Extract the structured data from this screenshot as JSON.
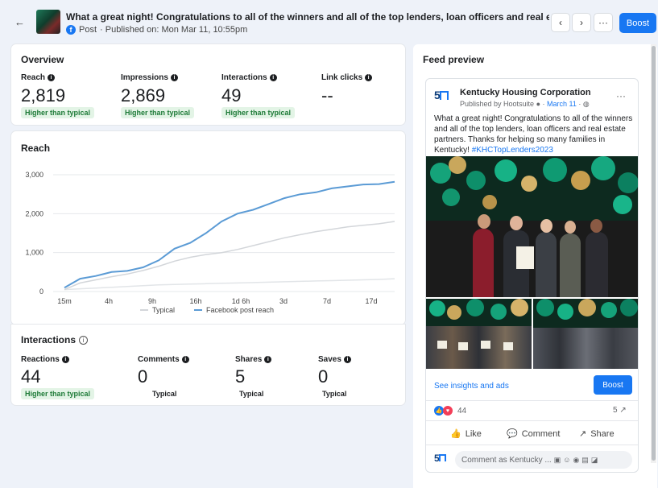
{
  "header": {
    "back_icon": "arrow-left-icon",
    "title": "What a great night! Congratulations to all of the winners and all of the top lenders, loan officers and real estate partn...",
    "post_type": "Post",
    "published": "· Published on: Mon Mar 11, 10:55pm",
    "prev_glyph": "‹",
    "next_glyph": "›",
    "more_glyph": "···",
    "boost_label": "Boost"
  },
  "overview": {
    "title": "Overview",
    "metrics": [
      {
        "label": "Reach",
        "value": "2,819",
        "badge": "Higher than typical"
      },
      {
        "label": "Impressions",
        "value": "2,869",
        "badge": "Higher than typical"
      },
      {
        "label": "Interactions",
        "value": "49",
        "badge": "Higher than typical"
      },
      {
        "label": "Link clicks",
        "value": "--",
        "badge": ""
      }
    ]
  },
  "reach_chart": {
    "title": "Reach",
    "legend_typical": "Typical",
    "legend_reach": "Facebook post reach"
  },
  "chart_data": {
    "type": "line",
    "y_ticks": [
      "0",
      "1,000",
      "2,000",
      "3,000"
    ],
    "ylim": [
      0,
      3000
    ],
    "x_ticks": [
      "15m",
      "4h",
      "9h",
      "16h",
      "1d 6h",
      "3d",
      "7d",
      "17d"
    ],
    "series": [
      {
        "name": "Facebook post reach",
        "color": "#5b9bd5",
        "values": [
          100,
          330,
          400,
          500,
          530,
          620,
          800,
          1100,
          1250,
          1500,
          1800,
          2000,
          2100,
          2250,
          2400,
          2500,
          2550,
          2650,
          2700,
          2750,
          2760,
          2820
        ]
      },
      {
        "name": "Typical",
        "color": "#d3d6da",
        "values": [
          50,
          220,
          300,
          380,
          450,
          540,
          650,
          780,
          880,
          950,
          1000,
          1080,
          1180,
          1280,
          1380,
          1460,
          1540,
          1600,
          1660,
          1700,
          1740,
          1800
        ]
      },
      {
        "name": "",
        "color": "#e2e5e8",
        "values": [
          50,
          70,
          90,
          110,
          130,
          150,
          170,
          180,
          190,
          200,
          210,
          220,
          230,
          240,
          250,
          260,
          270,
          280,
          290,
          300,
          310,
          330
        ]
      }
    ],
    "grid": true
  },
  "interactions": {
    "title": "Interactions",
    "info_icon": "info-circle-icon",
    "metrics": [
      {
        "label": "Reactions",
        "value": "44",
        "badge": "Higher than typical"
      },
      {
        "label": "Comments",
        "value": "0",
        "badge": "Typical"
      },
      {
        "label": "Shares",
        "value": "5",
        "badge": "Typical"
      },
      {
        "label": "Saves",
        "value": "0",
        "badge": "Typical"
      }
    ]
  },
  "feed_preview": {
    "title": "Feed preview",
    "page_name": "Kentucky Housing Corporation",
    "published_by": "Published by Hootsuite",
    "date": "March 11",
    "post_text": "What a great night! Congratulations to all of the winners and all of the top lenders, loan officers and real estate partners. Thanks for helping so many families in Kentucky! ",
    "hashtag": "#KHCTopLenders2023",
    "insights_link": "See insights and ads",
    "boost_label": "Boost",
    "reactions_count": "44",
    "shares_count": "5",
    "like_label": "Like",
    "comment_label": "Comment",
    "share_label": "Share",
    "comment_placeholder": "Comment as Kentucky ..."
  },
  "colors": {
    "accent": "#1877f2",
    "badge_bg": "#e3f4e6",
    "badge_text": "#1d7a37"
  }
}
